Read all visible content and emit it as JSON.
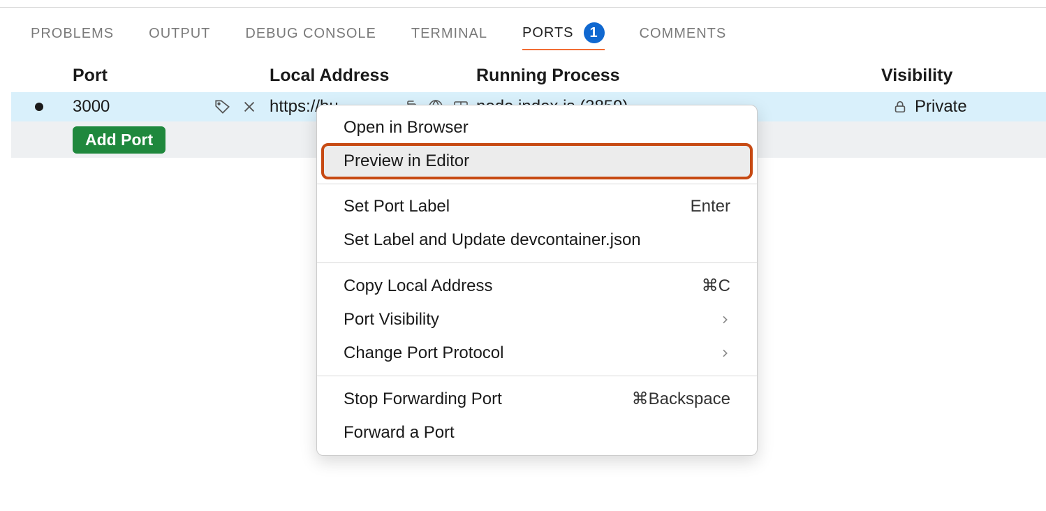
{
  "tabs": {
    "problems": "PROBLEMS",
    "output": "OUTPUT",
    "debug": "DEBUG CONSOLE",
    "terminal": "TERMINAL",
    "ports": "PORTS",
    "ports_badge": "1",
    "comments": "COMMENTS"
  },
  "headers": {
    "port": "Port",
    "local_address": "Local Address",
    "running_process": "Running Process",
    "visibility": "Visibility"
  },
  "row": {
    "port": "3000",
    "address_partial": "https://bu",
    "process_partial": "node index.js (3859)",
    "visibility": "Private"
  },
  "addport": {
    "label": "Add Port"
  },
  "menu": {
    "open_browser": "Open in Browser",
    "preview_editor": "Preview in Editor",
    "set_port_label": "Set Port Label",
    "set_port_label_shortcut": "Enter",
    "set_label_devcontainer": "Set Label and Update devcontainer.json",
    "copy_local_address": "Copy Local Address",
    "copy_local_address_shortcut": "⌘C",
    "port_visibility": "Port Visibility",
    "change_protocol": "Change Port Protocol",
    "stop_forwarding": "Stop Forwarding Port",
    "stop_forwarding_shortcut": "⌘Backspace",
    "forward_port": "Forward a Port"
  }
}
